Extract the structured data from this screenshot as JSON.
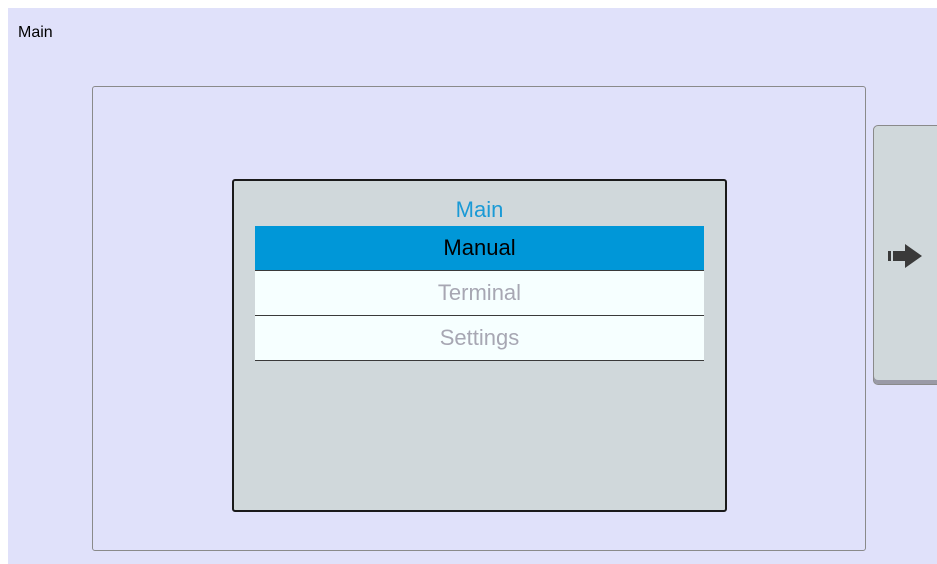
{
  "window": {
    "title": "Main"
  },
  "menu": {
    "title": "Main",
    "items": [
      {
        "label": "Manual",
        "selected": true
      },
      {
        "label": "Terminal",
        "selected": false
      },
      {
        "label": "Settings",
        "selected": false
      }
    ]
  },
  "nav": {
    "next_icon": "arrow-right-icon"
  },
  "colors": {
    "background": "#e0e1fa",
    "menu_bg": "#d0d8db",
    "selected": "#0097d8",
    "title_accent": "#1a9ad6",
    "item_bg": "#f6ffff",
    "item_text_disabled": "#a7a7b3"
  }
}
